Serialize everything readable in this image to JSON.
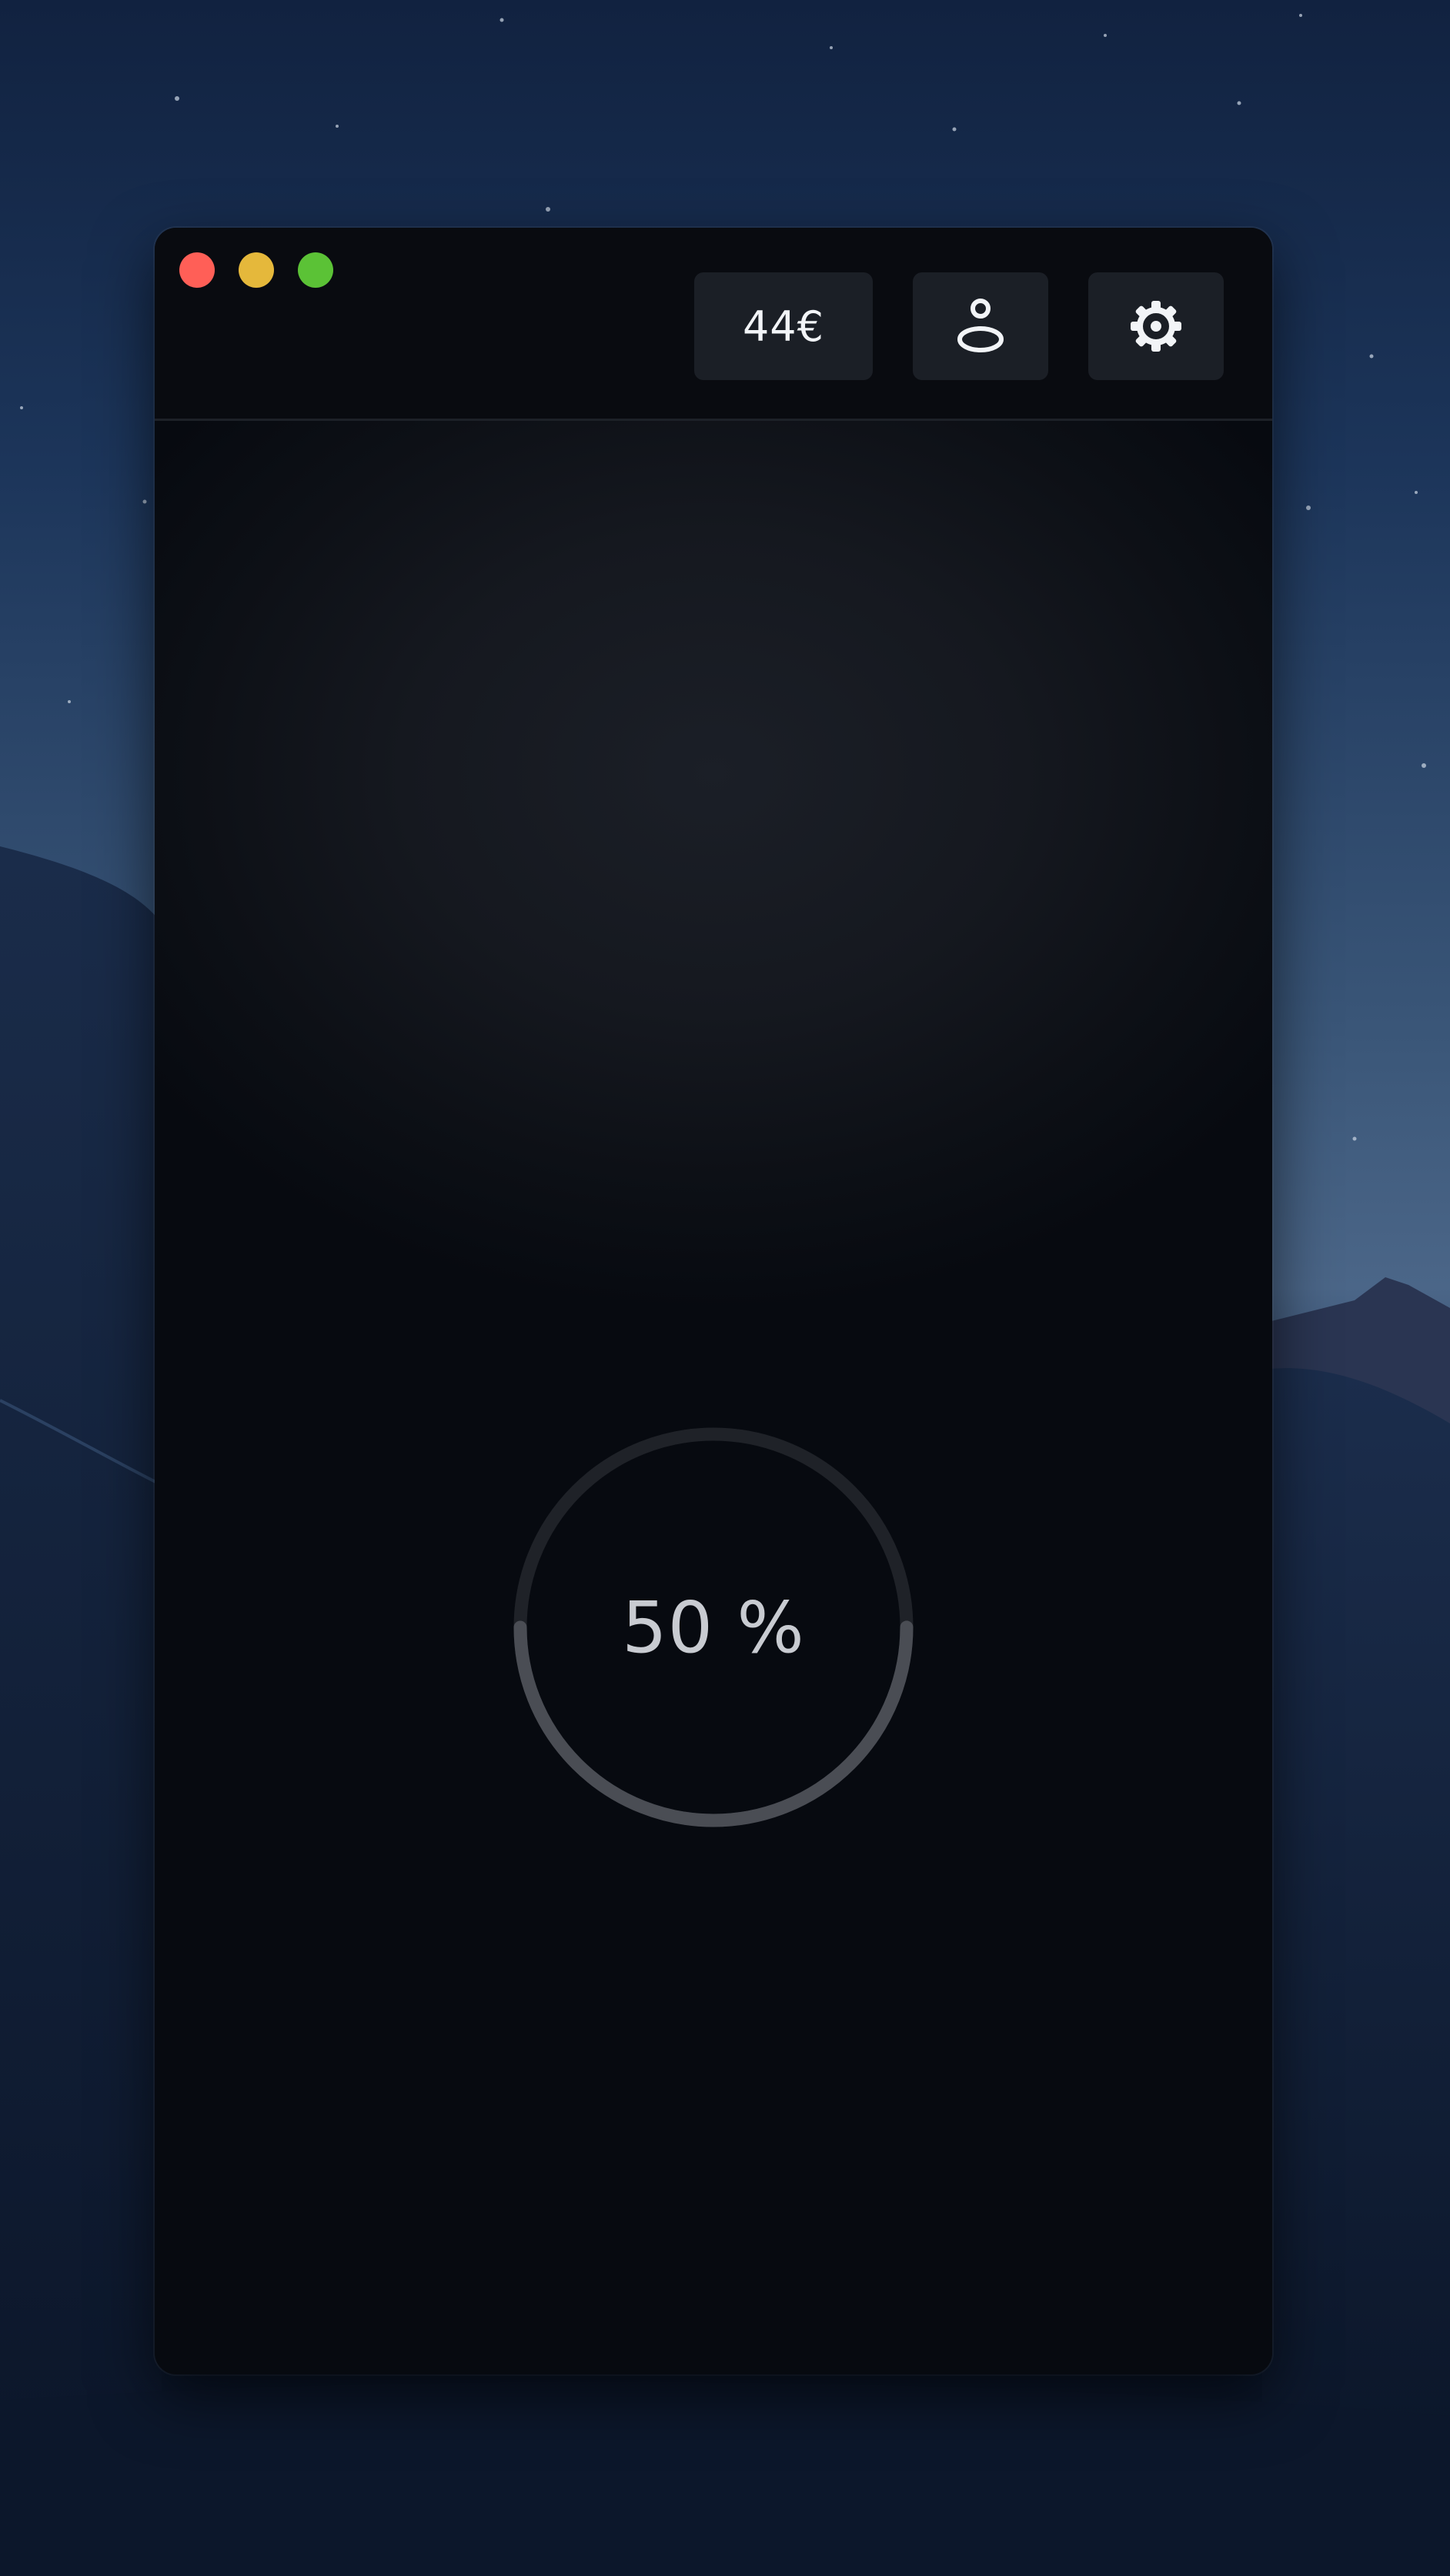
{
  "window": {
    "controls": {
      "close_color": "#ff5f57",
      "minimize_color": "#e5b83b",
      "zoom_color": "#5bc236"
    }
  },
  "toolbar": {
    "balance_label": "44€",
    "profile_icon": "user-icon",
    "settings_icon": "gear-icon"
  },
  "progress": {
    "value": 0.5,
    "label": "50 %"
  },
  "colors": {
    "progress_track": "#1f2228",
    "progress_fill": "#4a4d54",
    "window_bg": "#0b0d12",
    "button_bg": "#1b1f26"
  }
}
